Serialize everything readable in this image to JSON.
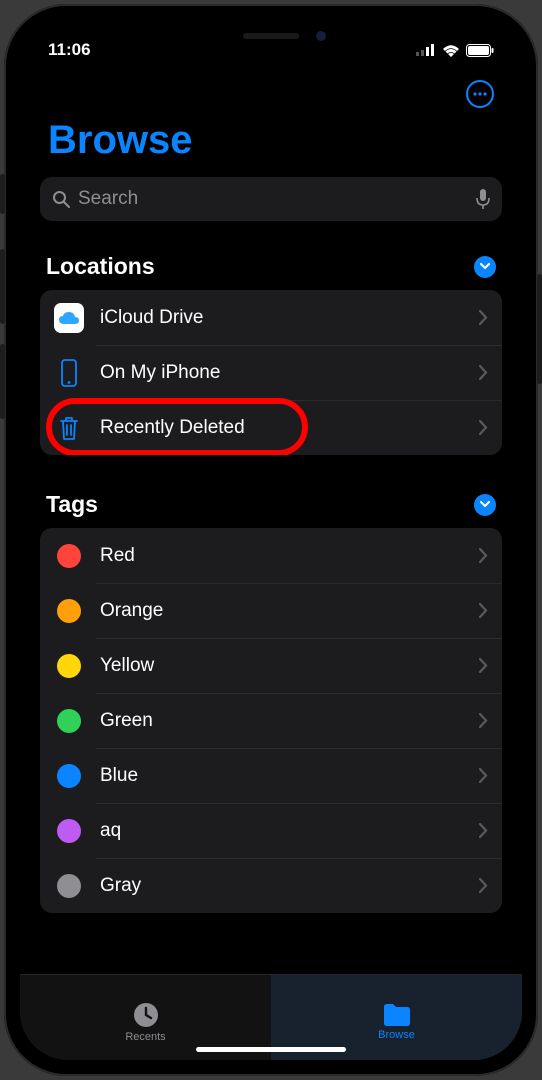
{
  "status": {
    "time": "11:06"
  },
  "page": {
    "title": "Browse"
  },
  "search": {
    "placeholder": "Search"
  },
  "sections": {
    "locations": {
      "title": "Locations",
      "items": [
        {
          "label": "iCloud Drive"
        },
        {
          "label": "On My iPhone"
        },
        {
          "label": "Recently Deleted"
        }
      ]
    },
    "tags": {
      "title": "Tags",
      "items": [
        {
          "label": "Red",
          "color": "#ff453a"
        },
        {
          "label": "Orange",
          "color": "#ff9f0a"
        },
        {
          "label": "Yellow",
          "color": "#ffd60a"
        },
        {
          "label": "Green",
          "color": "#30d158"
        },
        {
          "label": "Blue",
          "color": "#0a84ff"
        },
        {
          "label": "aq",
          "color": "#bf5af2"
        },
        {
          "label": "Gray",
          "color": "#8e8e93"
        }
      ]
    }
  },
  "tabs": {
    "recents": "Recents",
    "browse": "Browse"
  }
}
